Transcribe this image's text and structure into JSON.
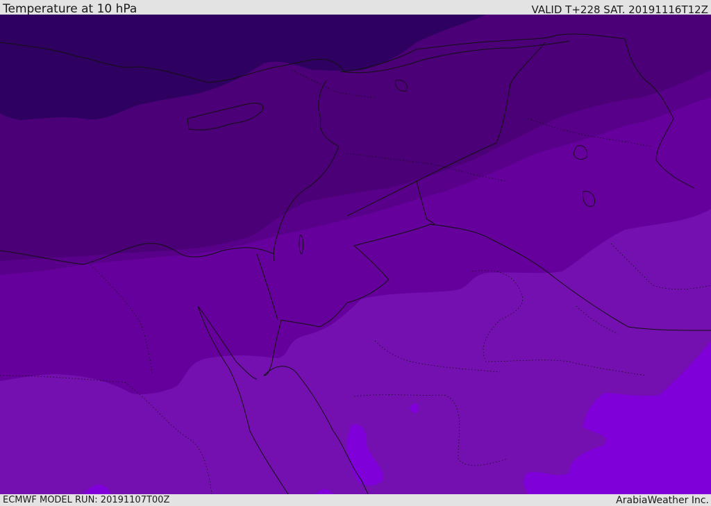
{
  "header": {
    "title": "Temperature at 10 hPa",
    "valid": "VALID T+228 SAT. 20191116T12Z"
  },
  "footer": {
    "model_run": "ECMWF MODEL RUN: 20191107T00Z",
    "credit": "ArabiaWeather Inc."
  },
  "palette": {
    "band_coldest": "#2e0060",
    "band_cold": "#4b0078",
    "band_cool": "#59008a",
    "band_mid": "#66009c",
    "band_warm": "#7510b0",
    "band_warmest": "#7f00d8",
    "border_line": "#111111"
  }
}
